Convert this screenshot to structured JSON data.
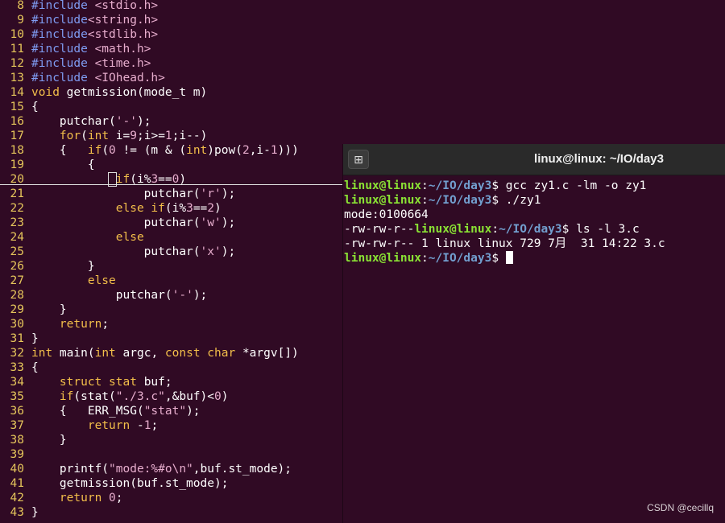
{
  "editor": {
    "lines": [
      {
        "n": "8",
        "html": "<span class=\"pp\">#include</span> <span class=\"str\">&lt;stdio.h&gt;</span>"
      },
      {
        "n": "9",
        "html": "<span class=\"pp\">#include</span><span class=\"str\">&lt;string.h&gt;</span>"
      },
      {
        "n": "10",
        "html": "<span class=\"pp\">#include</span><span class=\"str\">&lt;stdlib.h&gt;</span>"
      },
      {
        "n": "11",
        "html": "<span class=\"pp\">#include</span> <span class=\"str\">&lt;math.h&gt;</span>"
      },
      {
        "n": "12",
        "html": "<span class=\"pp\">#include</span> <span class=\"str\">&lt;time.h&gt;</span>"
      },
      {
        "n": "13",
        "html": "<span class=\"pp\">#include</span> <span class=\"str\">&lt;IOhead.h&gt;</span>"
      },
      {
        "n": "14",
        "html": "<span class=\"ty\">void</span> getmission(mode_t m)"
      },
      {
        "n": "15",
        "html": "{"
      },
      {
        "n": "16",
        "html": "    putchar(<span class=\"str\">'-'</span>);"
      },
      {
        "n": "17",
        "html": "    <span class=\"kw\">for</span>(<span class=\"ty\">int</span> i=<span class=\"num\">9</span>;i&gt;=<span class=\"num\">1</span>;i--)"
      },
      {
        "n": "18",
        "html": "    {   <span class=\"kw\">if</span>(<span class=\"num\">0</span> != (m &amp; (<span class=\"ty\">int</span>)pow(<span class=\"num\">2</span>,i-<span class=\"num\">1</span>)))"
      },
      {
        "n": "19",
        "html": "        {"
      },
      {
        "n": "20",
        "html": "           <span class=\"cursorbox\"> </span><span class=\"kw\">if</span>(i%<span class=\"num\">3</span>==<span class=\"num\">0</span>)"
      },
      {
        "n": "21",
        "html": "                putchar(<span class=\"str\">'r'</span>);"
      },
      {
        "n": "22",
        "html": "            <span class=\"kw\">else</span> <span class=\"kw\">if</span>(i%<span class=\"num\">3</span>==<span class=\"num\">2</span>)"
      },
      {
        "n": "23",
        "html": "                putchar(<span class=\"str\">'w'</span>);"
      },
      {
        "n": "24",
        "html": "            <span class=\"kw\">else</span>"
      },
      {
        "n": "25",
        "html": "                putchar(<span class=\"str\">'x'</span>);"
      },
      {
        "n": "26",
        "html": "        }"
      },
      {
        "n": "27",
        "html": "        <span class=\"kw\">else</span>"
      },
      {
        "n": "28",
        "html": "            putchar(<span class=\"str\">'-'</span>);"
      },
      {
        "n": "29",
        "html": "    }"
      },
      {
        "n": "30",
        "html": "    <span class=\"kw\">return</span>;"
      },
      {
        "n": "31",
        "html": "}"
      },
      {
        "n": "32",
        "html": "<span class=\"ty\">int</span> main(<span class=\"ty\">int</span> argc, <span class=\"ty\">const</span> <span class=\"ty\">char</span> *argv[])"
      },
      {
        "n": "33",
        "html": "{"
      },
      {
        "n": "34",
        "html": "    <span class=\"ty\">struct</span> <span class=\"ty\">stat</span> buf;"
      },
      {
        "n": "35",
        "html": "    <span class=\"kw\">if</span>(stat(<span class=\"str\">\"./3.c\"</span>,&amp;buf)&lt;<span class=\"num\">0</span>)"
      },
      {
        "n": "36",
        "html": "    {   ERR_MSG(<span class=\"str\">\"stat\"</span>);"
      },
      {
        "n": "37",
        "html": "        <span class=\"kw\">return</span> -<span class=\"num\">1</span>;"
      },
      {
        "n": "38",
        "html": "    }"
      },
      {
        "n": "39",
        "html": ""
      },
      {
        "n": "40",
        "html": "    printf(<span class=\"str\">\"mode:%#o\\n\"</span>,buf.st_mode);"
      },
      {
        "n": "41",
        "html": "    getmission(buf.st_mode);"
      },
      {
        "n": "42",
        "html": "    <span class=\"kw\">return</span> <span class=\"num\">0</span>;"
      },
      {
        "n": "43",
        "html": "}"
      }
    ]
  },
  "terminal": {
    "title": "linux@linux: ~/IO/day3",
    "newtab_icon": "new-tab-icon",
    "new_tab_glyph": "⊞",
    "lines": [
      {
        "html": "<span class=\"pu\">linux@linux</span>:<span class=\"pp2\">~/IO/day3</span>$ gcc zy1.c -lm -o zy1"
      },
      {
        "html": "<span class=\"pu\">linux@linux</span>:<span class=\"pp2\">~/IO/day3</span>$ ./zy1"
      },
      {
        "html": "mode:0100664"
      },
      {
        "html": "-rw-rw-r--<span class=\"pu\">linux@linux</span>:<span class=\"pp2\">~/IO/day3</span>$ ls -l 3.c"
      },
      {
        "html": "-rw-rw-r-- 1 linux linux 729 7月  31 14:22 3.c"
      },
      {
        "html": "<span class=\"pu\">linux@linux</span>:<span class=\"pp2\">~/IO/day3</span>$ <span class=\"tcur\"></span>"
      }
    ]
  },
  "watermark": "CSDN @cecillq",
  "colors": {
    "background": "#300a24",
    "line_number": "#e5c55b",
    "keyword": "#f3bf4a",
    "preprocessor": "#7f9cf2",
    "string": "#e7adcd",
    "prompt_user": "#8ae234",
    "prompt_path": "#729fcf"
  }
}
